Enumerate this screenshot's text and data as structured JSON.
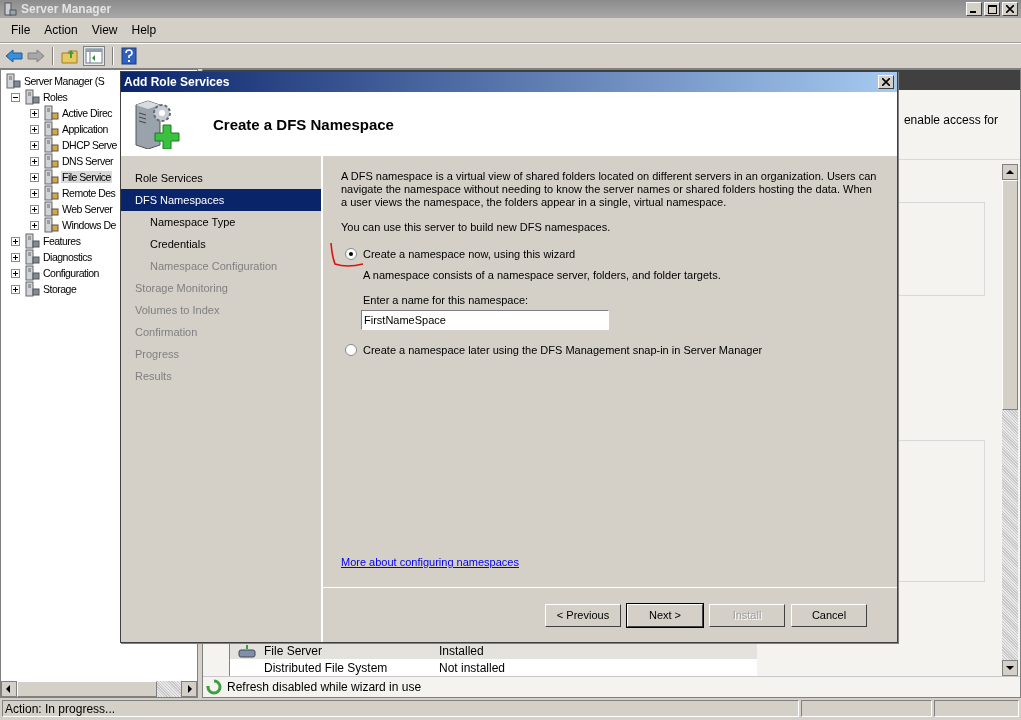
{
  "window": {
    "title": "Server Manager"
  },
  "menu": [
    "File",
    "Action",
    "View",
    "Help"
  ],
  "tree": {
    "items": [
      {
        "label": "Server Manager (S",
        "selected": false,
        "children": [
          {
            "label": "Roles",
            "expanded": true,
            "selected": false,
            "children": [
              {
                "label": "Active Direc",
                "expanded": false,
                "selected": false
              },
              {
                "label": "Application",
                "expanded": false,
                "selected": false
              },
              {
                "label": "DHCP Serve",
                "expanded": false,
                "selected": false
              },
              {
                "label": "DNS Server",
                "expanded": false,
                "selected": false
              },
              {
                "label": "File Service",
                "expanded": false,
                "selected": true
              },
              {
                "label": "Remote Des",
                "expanded": false,
                "selected": false
              },
              {
                "label": "Web Server",
                "expanded": false,
                "selected": false
              },
              {
                "label": "Windows De",
                "expanded": false,
                "selected": false
              }
            ]
          },
          {
            "label": "Features",
            "expanded": false,
            "selected": false
          },
          {
            "label": "Diagnostics",
            "expanded": false,
            "selected": false
          },
          {
            "label": "Configuration",
            "expanded": false,
            "selected": false
          },
          {
            "label": "Storage",
            "expanded": false,
            "selected": false
          }
        ]
      }
    ]
  },
  "details": {
    "description": "enable access for",
    "rows": [
      {
        "name": "File Server",
        "status": "Installed",
        "selected": true
      },
      {
        "name": "Distributed File System",
        "status": "Not installed",
        "selected": false
      }
    ],
    "notice": "Refresh disabled while wizard in use"
  },
  "status_bar": "Action:  In progress...",
  "dialog": {
    "title": "Add Role Services",
    "heading": "Create a DFS Namespace",
    "nav": [
      {
        "label": "Role Services",
        "selected": false,
        "disabled": false
      },
      {
        "label": "DFS Namespaces",
        "selected": true,
        "disabled": false,
        "children": [
          {
            "label": "Namespace Type",
            "selected": false,
            "disabled": false
          },
          {
            "label": "Credentials",
            "selected": false,
            "disabled": false
          },
          {
            "label": "Namespace Configuration",
            "selected": false,
            "disabled": true
          }
        ]
      },
      {
        "label": "Storage Monitoring",
        "selected": false,
        "disabled": true
      },
      {
        "label": "Volumes to Index",
        "selected": false,
        "disabled": true
      },
      {
        "label": "Confirmation",
        "selected": false,
        "disabled": true
      },
      {
        "label": "Progress",
        "selected": false,
        "disabled": true
      },
      {
        "label": "Results",
        "selected": false,
        "disabled": true
      }
    ],
    "intro": [
      "A DFS namespace is a virtual view of shared folders located on different servers in an organization. Users can navigate the namespace without needing to know the server names or shared folders hosting the data. When a user views the namespace, the folders appear in a single, virtual namespace.",
      "You can use this server to build new DFS namespaces."
    ],
    "options": [
      {
        "label": "Create a namespace now, using this wizard",
        "selected": true,
        "description": "A namespace consists of a namespace server, folders, and folder targets.",
        "field": {
          "label": "Enter a name for this namespace:",
          "value": "FirstNameSpace"
        }
      },
      {
        "label": "Create a namespace later using the DFS Management snap-in in Server Manager",
        "selected": false
      }
    ],
    "link": "More about configuring namespaces",
    "buttons": [
      {
        "label": "< Previous",
        "default": false,
        "disabled": false
      },
      {
        "label": "Next >",
        "default": true,
        "disabled": false
      },
      {
        "label": "Install",
        "default": false,
        "disabled": true
      },
      {
        "label": "Cancel",
        "default": false,
        "disabled": false
      }
    ]
  }
}
